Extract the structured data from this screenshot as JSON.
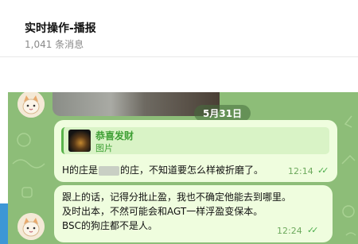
{
  "header": {
    "title": "实时操作-播报",
    "subtitle": "1,041 条消息"
  },
  "date_separator": "5月31日",
  "message1": {
    "reply": {
      "title": "恭喜发财",
      "subtitle": "图片"
    },
    "text_before": "H的庄是",
    "text_after": "的庄，不知道要怎么样被折磨了。",
    "time": "12:14",
    "status": "read-double-check"
  },
  "message2": {
    "lines": [
      "跟上的话，记得分批止盈，我也不确定他能去到哪里。",
      "及时出本，不然可能会和AGT一样浮盈变保本。",
      "BSC的狗庄都不是人。"
    ],
    "time": "12:24",
    "status": "read-double-check"
  },
  "colors": {
    "chat_bg": "#8dbd78",
    "bubble": "#effdde",
    "accent_green": "#59b34b",
    "left_accent": "#3d97d6"
  }
}
